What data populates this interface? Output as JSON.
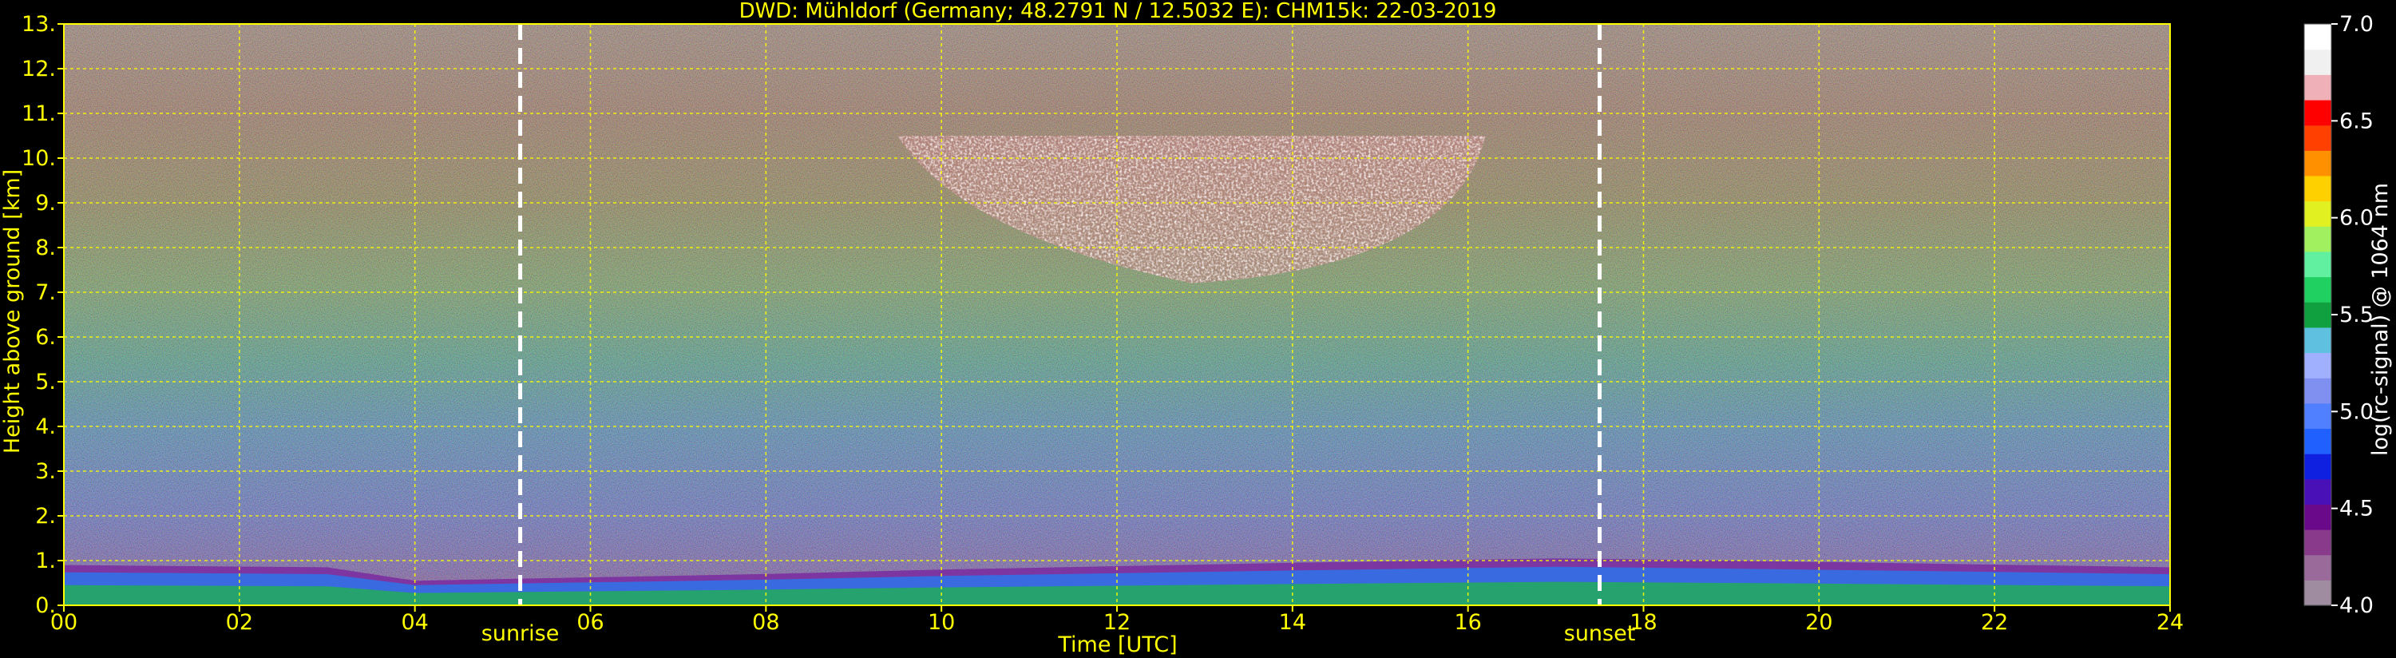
{
  "chart_data": {
    "type": "heatmap",
    "title": "DWD: Mühldorf (Germany; 48.2791 N / 12.5032 E):    CHM15k: 22-03-2019",
    "xlabel": "Time [UTC]",
    "ylabel": "Height above ground [km]",
    "colorbar_label": "log(rc-signal) @ 1064 nm",
    "xlim": [
      0,
      24
    ],
    "ylim": [
      0,
      13
    ],
    "x_ticks": [
      "00",
      "02",
      "04",
      "06",
      "08",
      "10",
      "12",
      "14",
      "16",
      "18",
      "20",
      "22",
      "24"
    ],
    "y_ticks": [
      "0.",
      "1.",
      "2.",
      "3.",
      "4.",
      "5.",
      "6.",
      "7.",
      "8.",
      "9.",
      "10.",
      "11.",
      "12.",
      "13."
    ],
    "colorbar_range": [
      4.0,
      7.0
    ],
    "colorbar_ticks": [
      "4.0",
      "4.5",
      "5.0",
      "5.5",
      "6.0",
      "6.5",
      "7.0"
    ],
    "grid": true,
    "markers": [
      {
        "label": "sunrise",
        "x": 5.2
      },
      {
        "label": "sunset",
        "x": 17.5
      }
    ],
    "colorbar_colors": [
      "#a08ca0",
      "#9a6a9a",
      "#8a3a8a",
      "#6a0a8a",
      "#4a10b8",
      "#1020e0",
      "#2060ff",
      "#5080ff",
      "#8090f0",
      "#a0b0ff",
      "#60c0e0",
      "#10a040",
      "#20d060",
      "#60f0a0",
      "#a0f060",
      "#e0f020",
      "#ffd000",
      "#ff9000",
      "#ff4000",
      "#ff0000",
      "#f0b0b8",
      "#f0f0f0",
      "#ffffff"
    ],
    "text_color": "#ffff00",
    "cloud_layers": [
      {
        "name": "boundary layer",
        "t_start": 0,
        "t_end": 24,
        "h_top_profile": [
          [
            0,
            0.9
          ],
          [
            3,
            0.85
          ],
          [
            4,
            0.55
          ],
          [
            8,
            0.7
          ],
          [
            10,
            0.8
          ],
          [
            14,
            0.95
          ],
          [
            17,
            1.05
          ],
          [
            19,
            1.0
          ],
          [
            24,
            0.85
          ]
        ]
      },
      {
        "name": "cirrus",
        "t_start": 9.5,
        "t_end": 16.2,
        "h_bottom": 7.2,
        "h_top": 10.5
      }
    ]
  }
}
